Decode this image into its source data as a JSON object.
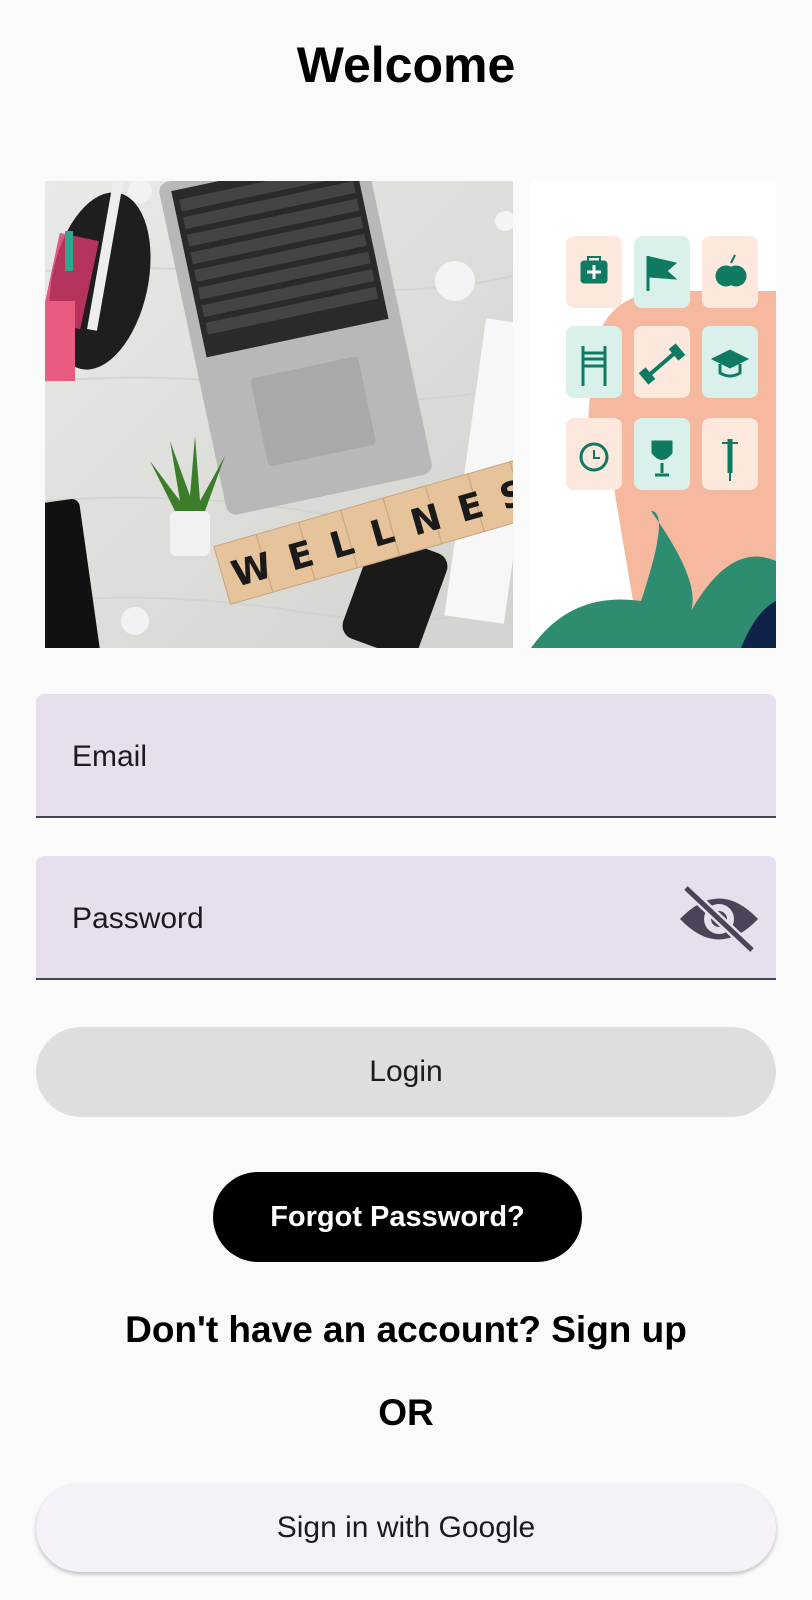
{
  "header": {
    "title": "Welcome"
  },
  "hero": {
    "tiles_word": "WELLNESS"
  },
  "form": {
    "email_label": "Email",
    "password_label": "Password",
    "password_toggle_icon": "visibility-off-icon",
    "login_label": "Login",
    "forgot_label": "Forgot Password?"
  },
  "signup": {
    "text": "Don't have an account? Sign up"
  },
  "divider": {
    "text": "OR"
  },
  "google": {
    "label": "Sign in with Google"
  },
  "colors": {
    "field_bg": "#e8dfec",
    "login_bg": "#dedede",
    "forgot_bg": "#000000",
    "google_bg": "#f6f0f8",
    "accent_teal": "#0f7a62",
    "peach": "#f6b9a0"
  }
}
